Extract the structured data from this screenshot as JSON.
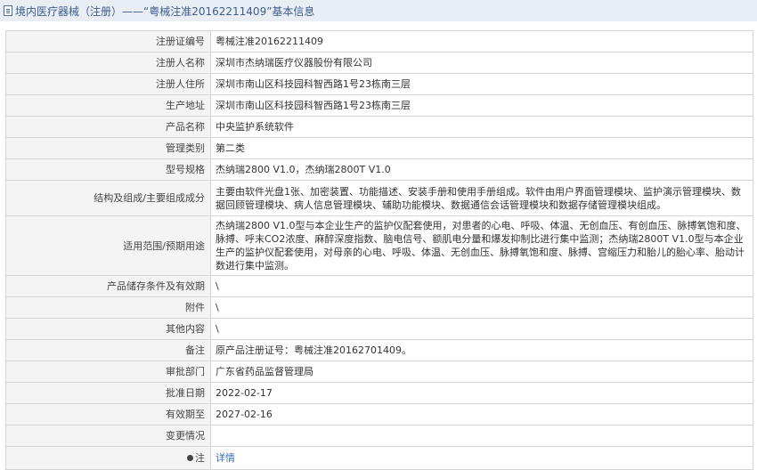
{
  "header": {
    "title": "境内医疗器械（注册）——“粤械注准20162211409”基本信息"
  },
  "rows": [
    {
      "label": "注册证编号",
      "value": "粤械注准20162211409"
    },
    {
      "label": "注册人名称",
      "value": "深圳市杰纳瑞医疗仪器股份有限公司"
    },
    {
      "label": "注册人住所",
      "value": "深圳市南山区科技园科智西路1号23栋南三层"
    },
    {
      "label": "生产地址",
      "value": "深圳市南山区科技园科智西路1号23栋南三层"
    },
    {
      "label": "产品名称",
      "value": "中央监护系统软件"
    },
    {
      "label": "管理类别",
      "value": "第二类"
    },
    {
      "label": "型号规格",
      "value": "杰纳瑞2800 V1.0，杰纳瑞2800T V1.0"
    },
    {
      "label": "结构及组成/主要组成成分",
      "value": "主要由软件光盘1张、加密装置、功能描述、安装手册和使用手册组成。软件由用户界面管理模块、监护演示管理模块、数据回顾管理模块、病人信息管理模块、辅助功能模块、数据通信会话管理模块和数据存储管理模块组成。"
    },
    {
      "label": "适用范围/预期用途",
      "value": "杰纳瑞2800 V1.0型与本企业生产的监护仪配套使用，对患者的心电、呼吸、体温、无创血压、有创血压、脉搏氧饱和度、脉搏、呼末CO2浓度、麻醉深度指数、脑电信号、额肌电分量和爆发抑制比进行集中监测；杰纳瑞2800T V1.0型与本企业生产的监护仪配套使用，对母亲的心电、呼吸、体温、无创血压、脉搏氧饱和度、脉搏、宫缩压力和胎儿的胎心率、胎动计数进行集中监测。"
    },
    {
      "label": "产品储存条件及有效期",
      "value": "\\"
    },
    {
      "label": "附件",
      "value": "\\"
    },
    {
      "label": "其他内容",
      "value": "\\"
    },
    {
      "label": "备注",
      "value": "原产品注册证号：粤械注准20162701409。"
    },
    {
      "label": "审批部门",
      "value": "广东省药品监督管理局"
    },
    {
      "label": "批准日期",
      "value": "2022-02-17"
    },
    {
      "label": "有效期至",
      "value": "2027-02-16"
    },
    {
      "label": "变更情况",
      "value": ""
    }
  ],
  "note": {
    "label": "注",
    "link_text": "详情"
  }
}
